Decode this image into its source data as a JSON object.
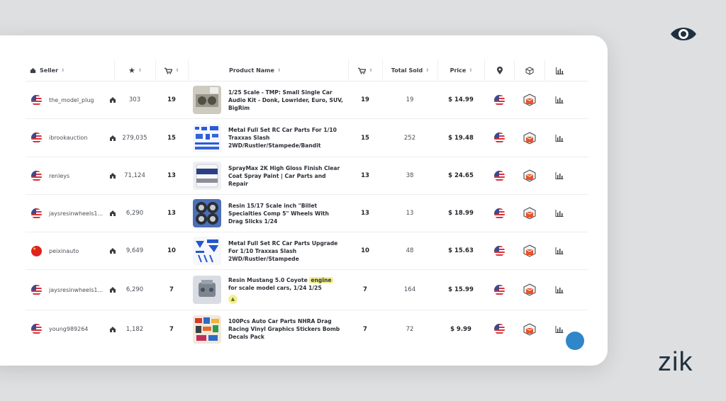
{
  "brand": {
    "name": "zik",
    "eye_icon": "eye-icon"
  },
  "headers": {
    "seller": "Seller",
    "rating_icon": "star-icon",
    "sales_icon": "cart-icon",
    "product": "Product Name",
    "product_sales_icon": "cart-icon",
    "total_sold": "Total Sold",
    "price": "Price",
    "location_icon": "location-pin-icon",
    "box_icon": "box-icon",
    "chart_icon": "bar-chart-icon"
  },
  "rows": [
    {
      "seller": "the_model_plug",
      "flag": "us",
      "rating": "303",
      "sales": "19",
      "product": "1/25 Scale - TMP: Small Single Car Audio Kit - Donk, Lowrider, Euro, SUV, BigRim",
      "product_sales": "19",
      "total_sold": "19",
      "price": "$ 14.99",
      "location": "us"
    },
    {
      "seller": "ibrookauction",
      "flag": "us",
      "rating": "279,035",
      "sales": "15",
      "product": "Metal Full Set RC Car Parts For 1/10 Traxxas Slash 2WD/Rustler/Stampede/Bandit",
      "product_sales": "15",
      "total_sold": "252",
      "price": "$ 19.48",
      "location": "us"
    },
    {
      "seller": "renleys",
      "flag": "us",
      "rating": "71,124",
      "sales": "13",
      "product": "SprayMax 2K High Gloss Finish Clear Coat Spray Paint | Car Parts and Repair",
      "product_sales": "13",
      "total_sold": "38",
      "price": "$ 24.65",
      "location": "us"
    },
    {
      "seller": "jaysresinwheels1...",
      "flag": "us",
      "rating": "6,290",
      "sales": "13",
      "product": "Resin 15/17 Scale inch \"Billet Specialties Comp 5\" Wheels With Drag Slicks 1/24",
      "product_sales": "13",
      "total_sold": "13",
      "price": "$ 18.99",
      "location": "us"
    },
    {
      "seller": "peixinauto",
      "flag": "cn",
      "rating": "9,649",
      "sales": "10",
      "product": "Metal Full Set RC Car Parts Upgrade For 1/10 Traxxas Slash 2WD/Rustler/Stampede",
      "product_sales": "10",
      "total_sold": "48",
      "price": "$ 15.63",
      "location": "us"
    },
    {
      "seller": "jaysresinwheels1...",
      "flag": "us",
      "rating": "6,290",
      "sales": "7",
      "product_before": "Resin Mustang 5.0 Coyote ",
      "product_highlight": "engine",
      "product_after": " for scale model cars, 1/24 1/25",
      "product_sales": "7",
      "total_sold": "164",
      "price": "$ 15.99",
      "location": "us",
      "warning": "▲"
    },
    {
      "seller": "young989264",
      "flag": "us",
      "rating": "1,182",
      "sales": "7",
      "product": "100Pcs Auto Car Parts NHRA Drag Racing Vinyl Graphics Stickers Bomb Decals Pack",
      "product_sales": "7",
      "total_sold": "72",
      "price": "$ 9.99",
      "location": "us"
    }
  ],
  "colors": {
    "accent": "#e8542a",
    "brand": "#1f3140",
    "highlight": "#f1f08c"
  }
}
